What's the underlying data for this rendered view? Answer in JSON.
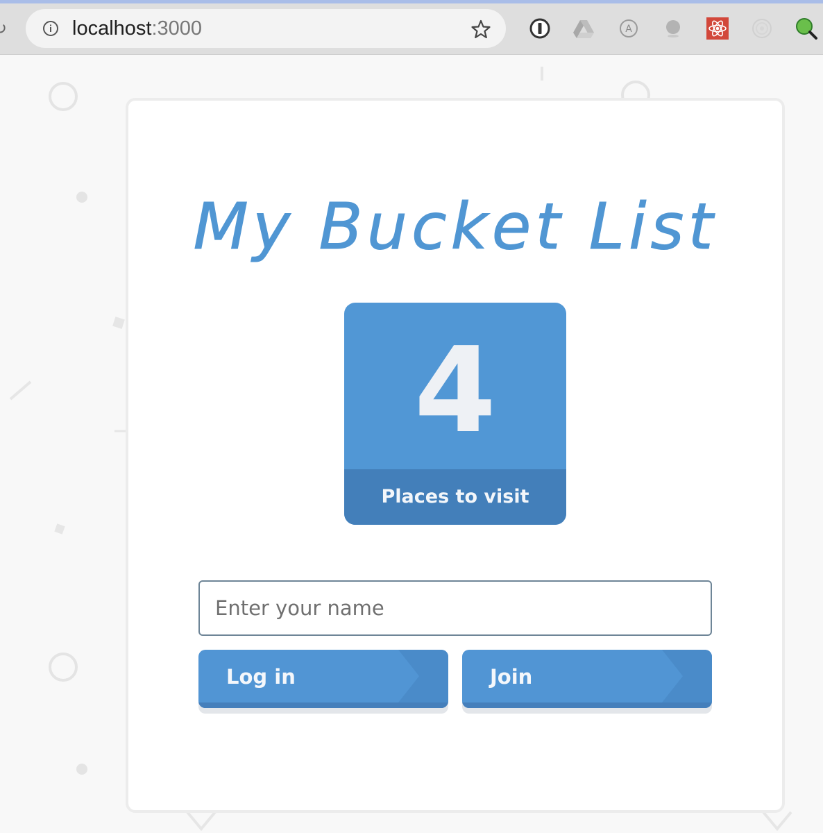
{
  "browser": {
    "url_host": "localhost",
    "url_port": ":3000",
    "icons": [
      "reload-icon",
      "site-info-icon",
      "bookmark-star-icon",
      "password-manager-icon",
      "drive-icon",
      "autofill-icon",
      "circle-extension-icon",
      "react-devtools-icon",
      "radar-extension-icon",
      "search-extension-icon"
    ]
  },
  "page": {
    "title": "My Bucket List",
    "counter": {
      "value": "4",
      "label": "Places to visit"
    },
    "name_input": {
      "placeholder": "Enter your name",
      "value": ""
    },
    "buttons": {
      "login_label": "Log in",
      "join_label": "Join"
    }
  },
  "colors": {
    "brand_blue": "#5197d5",
    "brand_blue_dark": "#437fba",
    "title_blue": "#5096d3"
  }
}
